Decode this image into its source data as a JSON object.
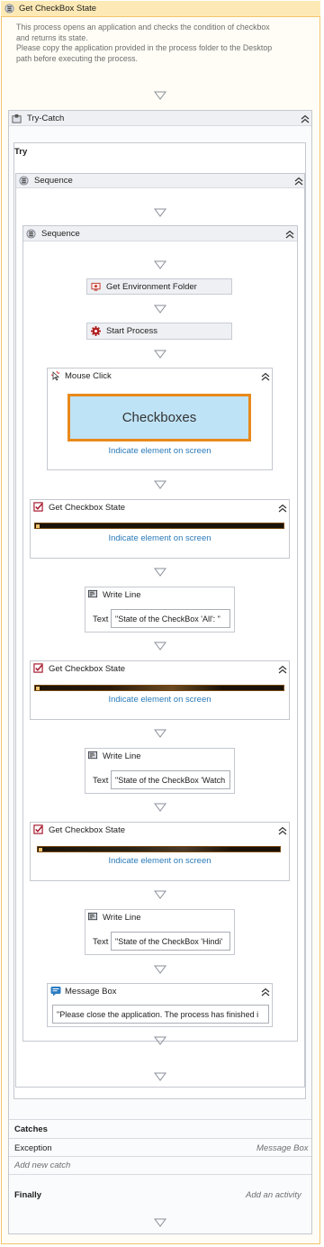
{
  "root": {
    "title": "Get CheckBox State",
    "description": [
      "This process opens an application and checks the condition of checkbox",
      "and returns its state.",
      "Please copy the application provided in the process folder to the Desktop",
      "path before executing the process."
    ]
  },
  "try_catch": {
    "title": "Try-Catch",
    "try_label": "Try",
    "catches_label": "Catches",
    "exception_label": "Exception",
    "exception_handler": "Message Box",
    "add_new_catch": "Add new catch",
    "finally_label": "Finally",
    "add_activity": "Add an activity"
  },
  "sequence_outer": {
    "title": "Sequence"
  },
  "sequence_inner": {
    "title": "Sequence"
  },
  "activities": {
    "get_env_folder": "Get Environment Folder",
    "start_process": "Start Process",
    "mouse_click": {
      "title": "Mouse Click",
      "preview_text": "Checkboxes",
      "indicate": "Indicate element on screen"
    },
    "get_checkbox_1": {
      "title": "Get Checkbox State",
      "indicate": "Indicate element on screen"
    },
    "write_line_1": {
      "title": "Write Line",
      "text_label": "Text",
      "text_value": "\"State of the CheckBox 'All': \""
    },
    "get_checkbox_2": {
      "title": "Get Checkbox State",
      "indicate": "Indicate element on screen"
    },
    "write_line_2": {
      "title": "Write Line",
      "text_label": "Text",
      "text_value": "\"State of the CheckBox 'Watch"
    },
    "get_checkbox_3": {
      "title": "Get Checkbox State",
      "indicate": "Indicate element on screen"
    },
    "write_line_3": {
      "title": "Write Line",
      "text_label": "Text",
      "text_value": "\"State of the CheckBox 'Hindi'"
    },
    "message_box": {
      "title": "Message Box",
      "text_value": "\"Please close the application. The process has finished i"
    }
  },
  "colors": {
    "root_header": "#fde9b5",
    "root_border": "#f2c46d",
    "activity_header": "#eef0f3",
    "link": "#2a7ab8",
    "highlight_border": "#e8891c",
    "preview_bg": "#bfe3f6"
  },
  "icons": {
    "sequence": "sequence-icon",
    "try_catch": "try-catch-icon",
    "collapse": "chevron-up-icon",
    "drop_arrow": "down-arrow-icon",
    "env_folder": "environment-folder-icon",
    "start_process": "gear-icon",
    "mouse_click": "mouse-click-icon",
    "checkbox": "checkbox-icon",
    "write_line": "write-line-icon",
    "message_box": "message-box-icon"
  }
}
